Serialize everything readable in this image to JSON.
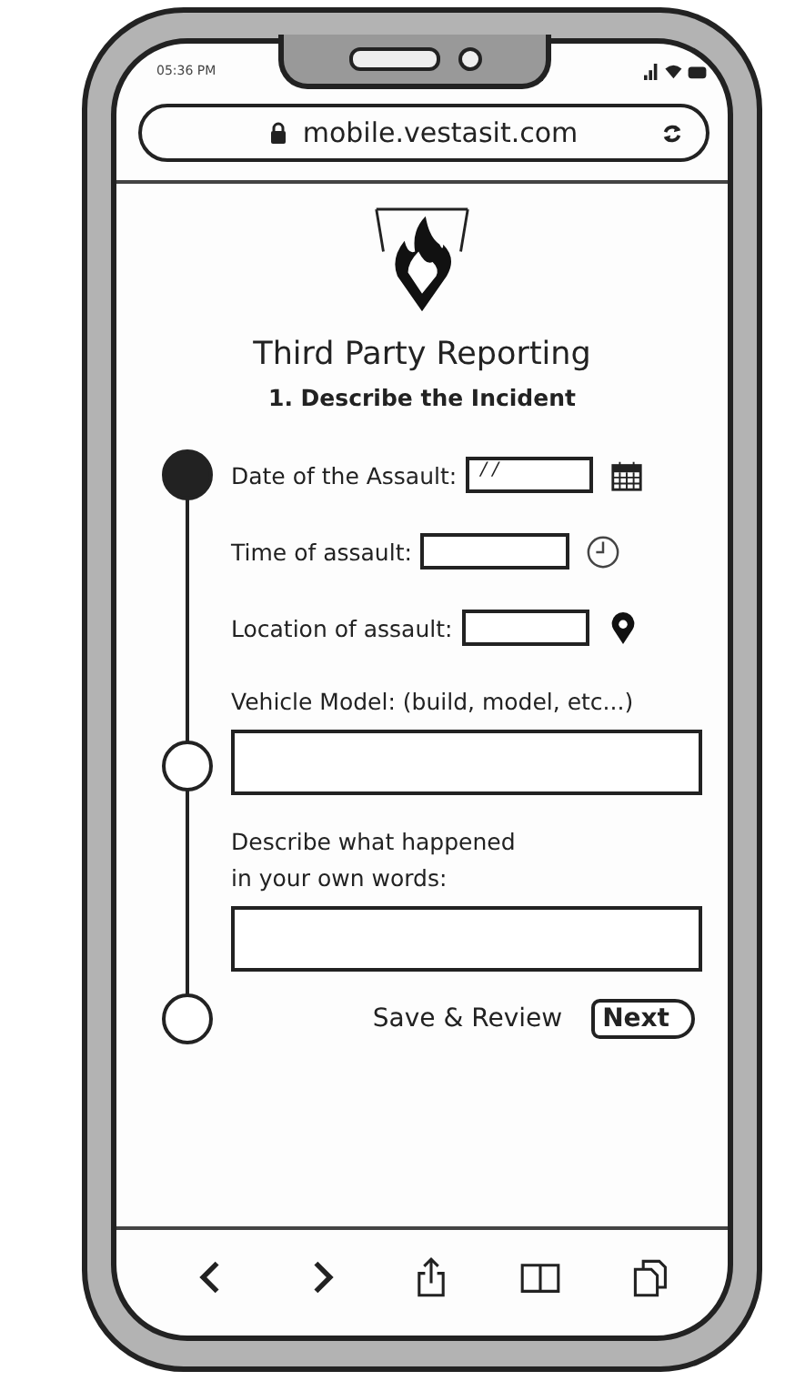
{
  "status_bar": {
    "time": "05:36 PM"
  },
  "address_bar": {
    "url": "mobile.vestasit.com"
  },
  "page": {
    "title": "Third Party Reporting",
    "subtitle": "1. Describe the Incident"
  },
  "form": {
    "fields": [
      {
        "kind": "inline",
        "label": "Date of the Assault:",
        "value": "/ /",
        "step_reached": true
      },
      {
        "kind": "inline",
        "label": "Time of assault:"
      },
      {
        "kind": "inline",
        "label": "Location of assault:"
      },
      {
        "kind": "block",
        "label": "Vehicle Model: (build, model, etc...)",
        "step_reached": false
      },
      {
        "kind": "block",
        "label": "Describe what happened\nin your own words:"
      }
    ],
    "actions": {
      "save": "Save & Review",
      "next": "Next",
      "step_reached": false
    }
  }
}
